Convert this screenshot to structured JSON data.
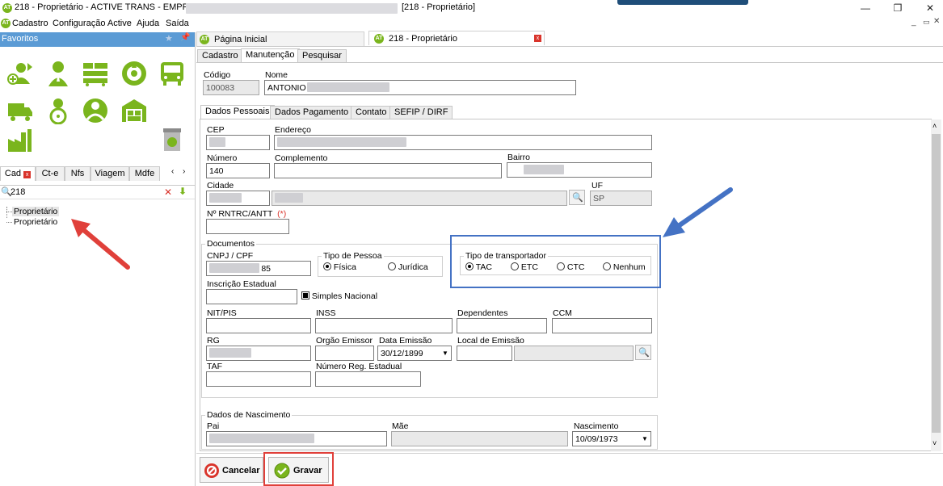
{
  "window": {
    "title_left": "218 - Proprietário - ACTIVE TRANS - EMPRESA: ",
    "title_right": "[218 - Proprietário]",
    "minimize": "—",
    "maximize": "❐",
    "close": "✕"
  },
  "menu": {
    "items": [
      "Cadastro",
      "Configuração Active",
      "Ajuda",
      "Saída"
    ]
  },
  "left_panel": {
    "header": "Favoritos",
    "group_tabs": [
      "Cad",
      "Ct-e",
      "Nfs",
      "Viagem",
      "Mdfe"
    ],
    "search_value": "218",
    "tree_items": [
      "Proprietário",
      "Proprietário"
    ]
  },
  "doc_tabs": {
    "home": "Página Inicial",
    "current": "218 - Proprietário"
  },
  "inner_tabs": [
    "Cadastro",
    "Manutenção",
    "Pesquisar"
  ],
  "header_fields": {
    "codigo_label": "Código",
    "codigo_value": "100083",
    "nome_label": "Nome",
    "nome_value": "ANTONIO"
  },
  "section_tabs": [
    "Dados Pessoais",
    "Dados Pagamento",
    "Contato",
    "SEFIP / DIRF"
  ],
  "address": {
    "cep_label": "CEP",
    "endereco_label": "Endereço",
    "numero_label": "Número",
    "numero_value": "140",
    "complemento_label": "Complemento",
    "bairro_label": "Bairro",
    "cidade_label": "Cidade",
    "uf_label": "UF",
    "uf_value": "SP",
    "rntrc_label": "Nº RNTRC/ANTT",
    "rntrc_required": "(*)"
  },
  "documents": {
    "group_label": "Documentos",
    "cnpj_label": "CNPJ / CPF",
    "cnpj_value": "85",
    "tipo_pessoa_label": "Tipo de Pessoa",
    "pessoa_options": [
      "Física",
      "Jurídica"
    ],
    "pessoa_selected": "Física",
    "tipo_transportador_label": "Tipo de transportador",
    "transportador_options": [
      "TAC",
      "ETC",
      "CTC",
      "Nenhum"
    ],
    "transportador_selected": "TAC",
    "ie_label": "Inscrição Estadual",
    "simples_label": "Simples Nacional",
    "nit_label": "NIT/PIS",
    "inss_label": "INSS",
    "dependentes_label": "Dependentes",
    "ccm_label": "CCM",
    "rg_label": "RG",
    "orgao_label": "Orgão Emissor",
    "data_emissao_label": "Data Emissão",
    "data_emissao_value": "30/12/1899",
    "local_emissao_label": "Local de Emissão",
    "taf_label": "TAF",
    "reg_estadual_label": "Número Reg. Estadual"
  },
  "birth": {
    "group_label": "Dados de Nascimento",
    "pai_label": "Pai",
    "mae_label": "Mãe",
    "nascimento_label": "Nascimento",
    "nascimento_value": "10/09/1973"
  },
  "footer": {
    "cancel_label": "Cancelar",
    "save_label": "Gravar"
  },
  "colors": {
    "brand_green": "#7ab51d",
    "header_blue": "#5b9bd5",
    "annotation_blue": "#4472c4",
    "annotation_red": "#e0403a"
  }
}
